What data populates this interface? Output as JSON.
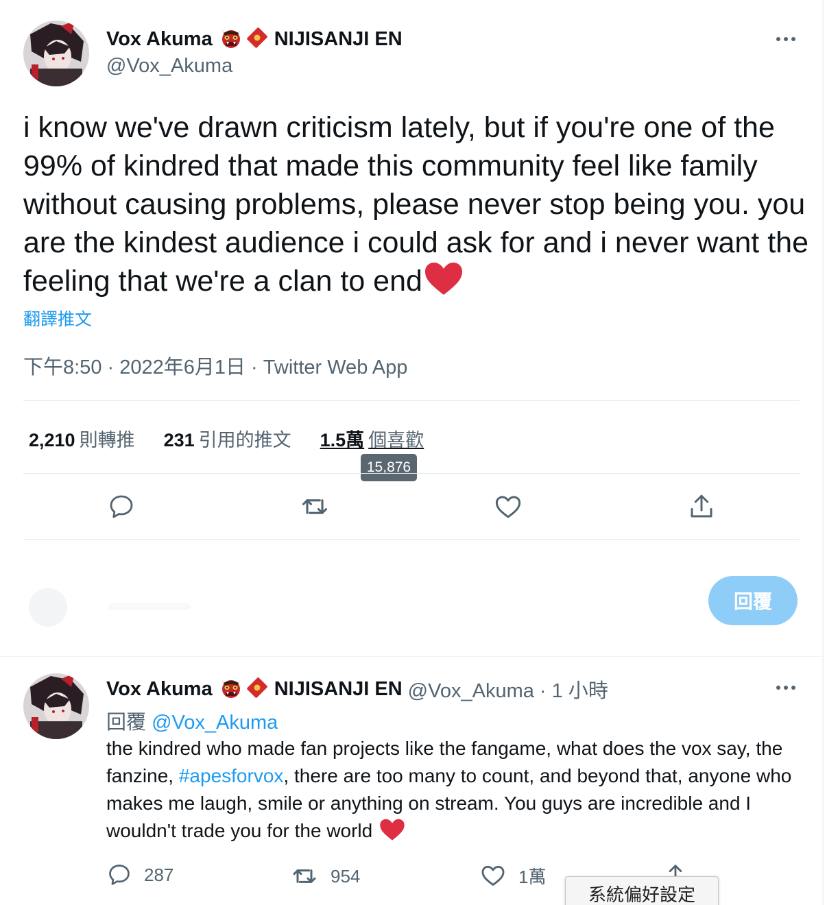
{
  "main_tweet": {
    "display_name": "Vox Akuma",
    "affiliation": "NIJISANJI EN",
    "handle": "@Vox_Akuma",
    "text": "i know we've drawn criticism lately, but if you're one of the 99% of kindred that made this community feel like family without causing problems, please never stop being you. you are the kindest audience i could ask for and i never want the feeling that we're a clan to end",
    "translate_label": "翻譯推文",
    "meta": "下午8:50 · 2022年6月1日 · Twitter Web App",
    "stats": {
      "retweets_value": "2,210",
      "retweets_label": "則轉推",
      "quotes_value": "231",
      "quotes_label": "引用的推文",
      "likes_value": "1.5萬",
      "likes_label": "個喜歡"
    },
    "likes_tooltip": "15,876",
    "reply_button": "回覆"
  },
  "reply_tweet": {
    "display_name": "Vox Akuma",
    "affiliation": "NIJISANJI EN",
    "handle_time": "@Vox_Akuma · 1 小時",
    "replying_prefix": "回覆",
    "replying_to": "@Vox_Akuma",
    "text_part1": "the kindred who made fan projects like the fangame, what does the vox say, the fanzine, ",
    "hashtag": "#apesforvox",
    "text_part2": ", there are too many to count, and beyond that, anyone who makes me laugh, smile or anything on stream. You guys are incredible and I wouldn't trade you for the world",
    "replies_count": "287",
    "retweets_count": "954",
    "likes_count": "1萬"
  },
  "system_tooltip": "系統偏好設定",
  "colors": {
    "accent": "#1d9bf0",
    "secondary_text": "#536471",
    "heart": "#dd2e44",
    "reply_button_disabled": "#8ecdf8"
  },
  "icons": [
    "oni-mask-emoji",
    "red-envelope-emoji",
    "heart-emoji",
    "reply-icon",
    "retweet-icon",
    "like-icon",
    "share-icon",
    "more-icon"
  ]
}
